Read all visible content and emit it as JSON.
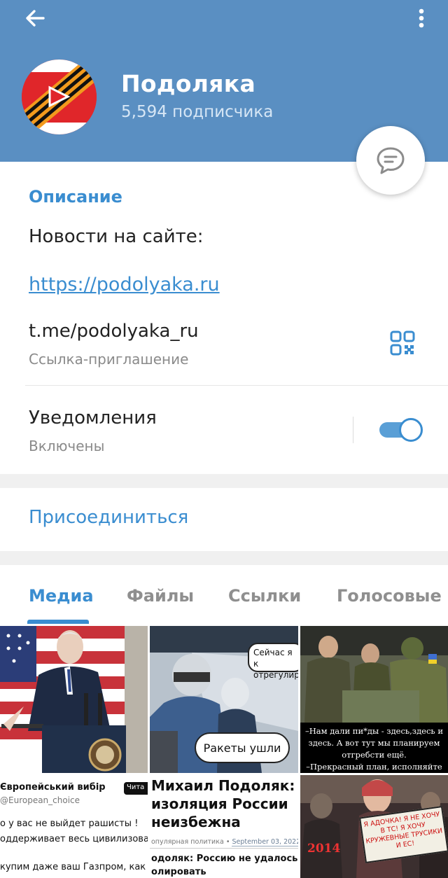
{
  "header": {
    "title": "Подоляка",
    "subtitle": "5,594 подписчика",
    "accent_color": "#5a8fc2",
    "icons": {
      "back": "arrow-left-icon",
      "menu": "kebab-menu-icon",
      "chat": "chat-bubble-icon"
    }
  },
  "info": {
    "section_title": "Описание",
    "description": "Новости на сайте:",
    "site_link": "https://podolyaka.ru",
    "invite_link": "t.me/podolyaka_ru",
    "invite_link_caption": "Ссылка-приглашение",
    "notifications_label": "Уведомления",
    "notifications_status": "Включены",
    "notifications_enabled": true
  },
  "join_label": "Присоединиться",
  "tabs": [
    {
      "label": "Медиа",
      "active": true
    },
    {
      "label": "Файлы",
      "active": false
    },
    {
      "label": "Ссылки",
      "active": false
    },
    {
      "label": "Голосовые",
      "active": false
    }
  ],
  "media": {
    "cell2": {
      "bubble_top": "Сейчас я к отрегулир",
      "bubble_bottom": "Ракеты ушли"
    },
    "cell3": {
      "caption_lines": [
        "–Нам дали пи*ды - здесь,здесь и",
        "здесь. А вот тут мы планируем",
        "отгребсти ещё.",
        "–Прекрасный план, исполняйте"
      ]
    },
    "cell4": {
      "title": "Європейський вибір",
      "handle": "@European_choice",
      "badge": "Чита",
      "line1": "о у вас не выйдет рашисты !",
      "line2": "оддерживает весь цивилизованн",
      "line3": "купим даже ваш Газпром, как ку"
    },
    "cell5": {
      "headline_lines": [
        "Михаил Подоляк:",
        "изоляция России",
        "неизбежна"
      ],
      "category": "опулярная политика",
      "date": "September 03, 2022",
      "sub_lines": [
        "одоляк: Россию не удалось",
        "олировать"
      ]
    },
    "cell6": {
      "year": "2014",
      "placard": "Я АДОЧКА! Я НЕ ХОЧУ В ТС! Я ХОЧУ КРУЖЕВНЫЕ ТРУСИКИ И ЕС!"
    }
  }
}
